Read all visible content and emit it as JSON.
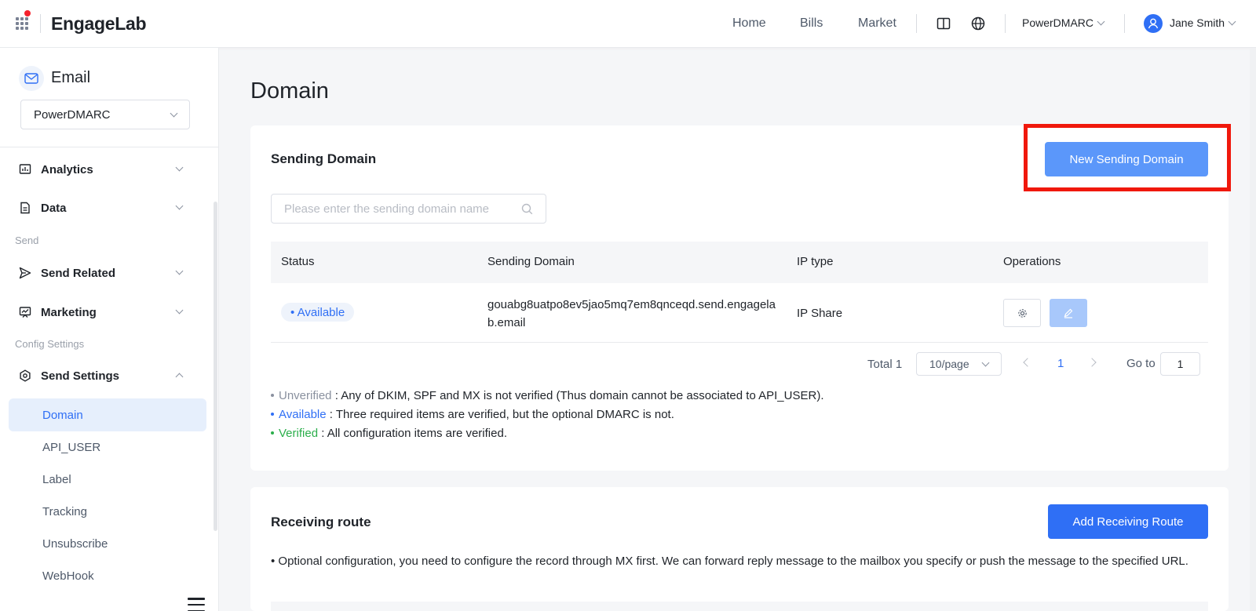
{
  "app": {
    "logo": "EngageLab",
    "nav": [
      "Home",
      "Bills",
      "Market"
    ],
    "org": "PowerDMARC",
    "user": "Jane Smith",
    "colors": {
      "primary": "#2f6ff5",
      "highlight": "#f0180c",
      "verified": "#2bae4b"
    }
  },
  "sidebar": {
    "product": "Email",
    "project": "PowerDMARC",
    "groups": {
      "send": "Send",
      "config": "Config Settings"
    },
    "items": {
      "analytics": "Analytics",
      "data": "Data",
      "send_related": "Send Related",
      "marketing": "Marketing",
      "send_settings": "Send Settings"
    },
    "sub_items": [
      "Domain",
      "API_USER",
      "Label",
      "Tracking",
      "Unsubscribe",
      "WebHook"
    ],
    "active": "Domain"
  },
  "page": {
    "title": "Domain"
  },
  "sending": {
    "title": "Sending Domain",
    "new_button": "New Sending Domain",
    "search_placeholder": "Please enter the sending domain name",
    "columns": [
      "Status",
      "Sending Domain",
      "IP type",
      "Operations"
    ],
    "rows": [
      {
        "status": "• Available",
        "domain": "gouabg8uatpo8ev5jao5mq7em8qnceqd.send.engagelab.email",
        "ip_type": "IP Share"
      }
    ],
    "pagination": {
      "total": "Total 1",
      "page_size": "10/page",
      "page": "1",
      "goto_label": "Go to",
      "goto_value": "1"
    },
    "legend": [
      {
        "term": "Unverified",
        "color": "#8a919f",
        "desc": " : Any of DKIM, SPF and MX is not verified (Thus domain cannot be associated to API_USER)."
      },
      {
        "term": "Available",
        "color": "#2f6ff5",
        "desc": " : Three required items are verified, but the optional DMARC is not."
      },
      {
        "term": "Verified",
        "color": "#2bae4b",
        "desc": " : All configuration items are verified."
      }
    ]
  },
  "receiving": {
    "title": "Receiving route",
    "add_button": "Add Receiving Route",
    "note": "• Optional configuration, you need to configure the record through MX first. We can forward reply message to the mailbox you specify or push the message to the specified URL."
  }
}
